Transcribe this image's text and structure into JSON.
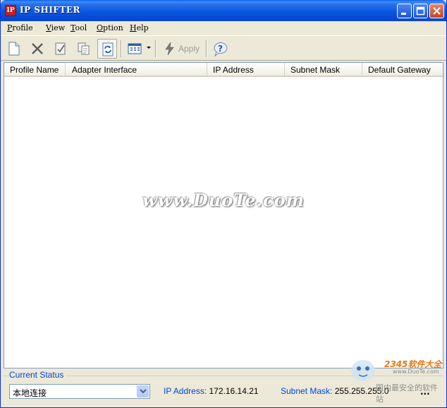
{
  "window": {
    "title": "IP SHIFTER",
    "icon_label": "IP"
  },
  "menu": [
    {
      "label": "Profile"
    },
    {
      "label": "View"
    },
    {
      "label": "Tool"
    },
    {
      "label": "Option"
    },
    {
      "label": "Help"
    }
  ],
  "toolbar": {
    "apply_label": "Apply",
    "icons": [
      "new-profile-icon",
      "delete-icon",
      "edit-icon",
      "copy-icon",
      "refresh-icon",
      "view-mode-icon",
      "apply-lightning-icon",
      "help-icon"
    ]
  },
  "list": {
    "columns": [
      "Profile Name",
      "Adapter Interface",
      "IP Address",
      "Subnet Mask",
      "Default Gateway"
    ],
    "rows": []
  },
  "watermark": "www.DuoTe.com",
  "status": {
    "title": "Current Status",
    "adapter": "本地连接",
    "ip_label": "IP Address:",
    "ip_value": "172.16.14.21",
    "mask_label": "Subnet Mask:",
    "mask_value": "255.255.255.0",
    "more": "..."
  },
  "corner_logo": {
    "line1": "2345软件大全",
    "line2": "www.DuoTe.com",
    "line3": "国内最安全的软件站"
  },
  "colors": {
    "titlebar": "#0a57df",
    "accent_text": "#0046d5",
    "window_bg": "#ece9d8"
  }
}
